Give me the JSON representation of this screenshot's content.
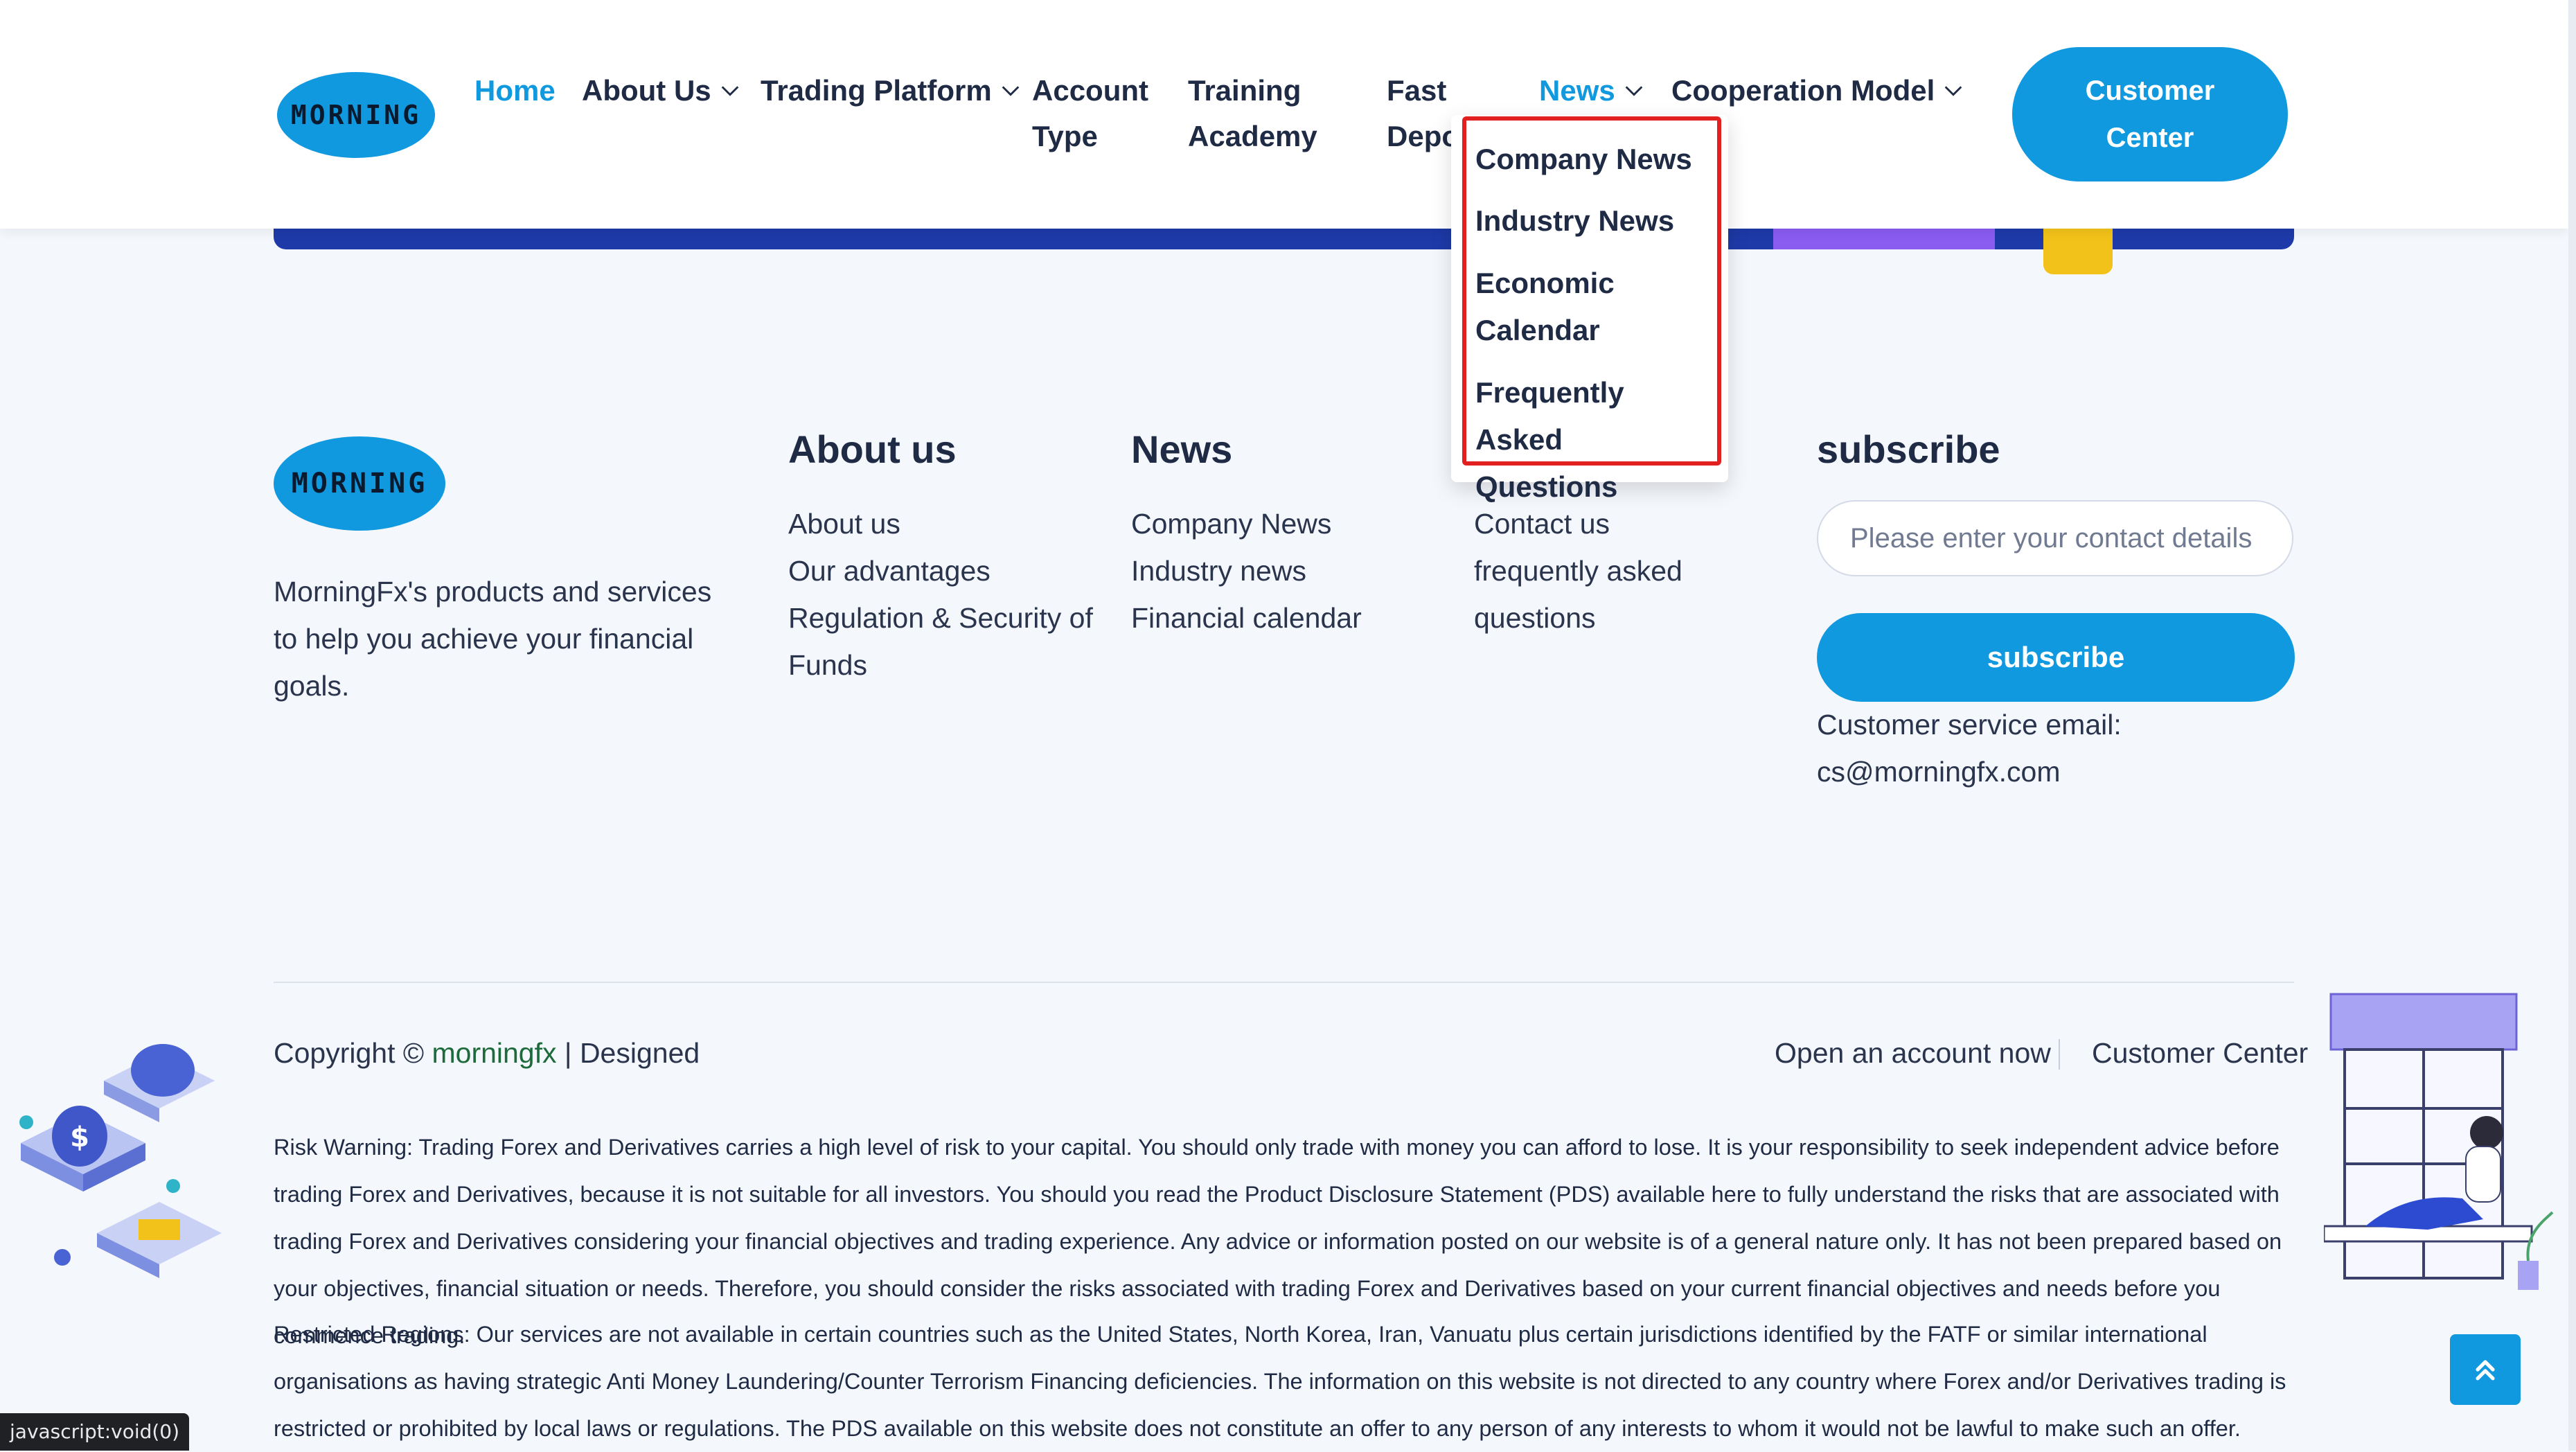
{
  "header": {
    "logo_text": "MORNING",
    "nav": [
      {
        "label": "Home",
        "active": true
      },
      {
        "label": "About Us",
        "has_dropdown": true
      },
      {
        "label": "Trading Platform",
        "has_dropdown": true
      },
      {
        "label": "Account\nType"
      },
      {
        "label": "Training\nAcademy"
      },
      {
        "label": "Fast\nDepo"
      },
      {
        "label": "News",
        "has_dropdown": true,
        "active": true
      },
      {
        "label": "Cooperation Model",
        "has_dropdown": true
      }
    ],
    "cta": "Customer\nCenter"
  },
  "news_dropdown": {
    "items": [
      "Company News",
      "Industry News",
      "Economic\nCalendar",
      "Frequently Asked\nQuestions"
    ]
  },
  "footer": {
    "logo_text": "MORNING",
    "description": "MorningFx's products and services to help you achieve your financial goals.",
    "about": {
      "title": "About us",
      "links": [
        "About us",
        "Our advantages",
        "Regulation & Security of Funds"
      ]
    },
    "news": {
      "title": "News",
      "links": [
        "Company News",
        "Industry news",
        "Financial calendar"
      ]
    },
    "support": {
      "links": [
        "Contact us",
        "frequently asked questions"
      ]
    },
    "subscribe": {
      "title": "subscribe",
      "placeholder": "Please enter your contact details",
      "button": "subscribe",
      "email_label": "Customer service email:",
      "email": "cs@morningfx.com"
    }
  },
  "bottom": {
    "copyright_prefix": "Copyright ©",
    "brand": "morningfx",
    "copyright_suffix": "| Designed",
    "open_account": "Open an account now",
    "customer_center": "Customer Center",
    "risk_warning": "Risk Warning: Trading Forex and Derivatives carries a high level of risk to your capital. You should only trade with money you can afford to lose. It is your responsibility to seek independent advice before trading Forex and Derivatives, because it is not suitable for all investors. You should you read the Product Disclosure Statement (PDS) available here to fully understand the risks that are associated with trading Forex and Derivatives considering your financial objectives and trading experience. Any advice or information posted on our website is of a general nature only. It has not been prepared based on your objectives, financial situation or needs. Therefore, you should consider the risks associated with trading Forex and Derivatives based on your current financial objectives and needs before you commence trading.",
    "restricted": "Restricted Regions: Our services are not available in certain countries such as the United States, North Korea, Iran, Vanuatu plus certain jurisdictions identified by the FATF or similar international organisations as having strategic Anti Money Laundering/Counter Terrorism Financing deficiencies. The information on this website is not directed to any country where Forex and/or Derivatives trading is restricted or prohibited by local laws or regulations. The PDS available on this website does not constitute an offer to any person of any interests to whom it would not be lawful to make such an offer."
  },
  "status_bar": "javascript:void(0)",
  "colors": {
    "accent": "#1199e0",
    "dark": "#1f2a44",
    "brand_link": "#1d6b3a",
    "highlight": "#e22020"
  }
}
